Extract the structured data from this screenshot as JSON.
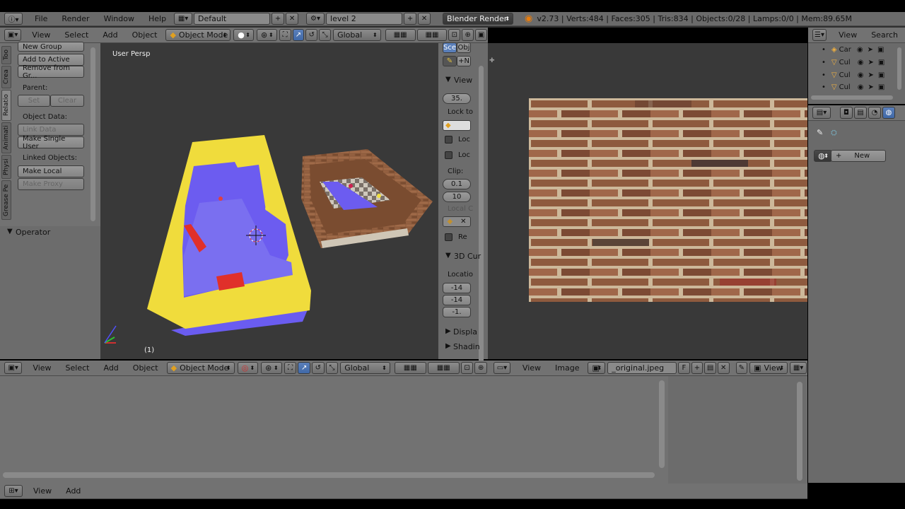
{
  "topbar": {
    "menus": [
      "File",
      "Render",
      "Window",
      "Help"
    ],
    "screen_layout": "Default",
    "scene": "level 2",
    "render_engine": "Blender Render",
    "stats": "v2.73 | Verts:484 | Faces:305 | Tris:834 | Objects:0/28 | Lamps:0/0 | Mem:89.65M"
  },
  "viewport_header": {
    "menus": [
      "View",
      "Select",
      "Add",
      "Object"
    ],
    "mode": "Object Mode",
    "orientation": "Global"
  },
  "tool_shelf": {
    "tabs": [
      "Too",
      "Crea",
      "Relatio",
      "Animati",
      "Physi",
      "Grease Pe"
    ],
    "group_buttons": [
      "New Group",
      "Add to Active",
      "Remove from Gr..."
    ],
    "parent_label": "Parent:",
    "parent_set": "Set",
    "parent_clear": "Clear",
    "object_data_label": "Object Data:",
    "link_data": "Link Data",
    "make_single_user": "Make Single User",
    "linked_objects_label": "Linked Objects:",
    "make_local": "Make Local",
    "make_proxy": "Make Proxy",
    "operator_label": "Operator"
  },
  "viewport": {
    "perspective_label": "User Persp",
    "frame_label": "(1)"
  },
  "properties_panel": {
    "tab_scene": "Sce",
    "tab_object": "Obj",
    "new_btn": "+N",
    "view_header": "View",
    "lens": "35.",
    "lock_to": "Lock to",
    "lock_loc": "Loc",
    "lock_loc2": "Loc",
    "clip_label": "Clip:",
    "clip_start": "0.1",
    "clip_end": "10",
    "local_camera": "Local C",
    "render_border": "Re",
    "cursor_header": "3D Cur",
    "location_label": "Locatio",
    "loc_x": "-14",
    "loc_y": "-14",
    "loc_z": "-1.",
    "display_header": "Displa",
    "shading_header": "Shadin"
  },
  "image_editor_header": {
    "menus": [
      "View",
      "Image"
    ],
    "image_name": "_original.jpeg",
    "fake_user": "F",
    "view_mode": "View"
  },
  "outliner": {
    "menus": [
      "View",
      "Search"
    ],
    "rows": [
      "Car",
      "Cul",
      "Cul",
      "Cul"
    ]
  },
  "properties_editor": {
    "new_button": "New"
  },
  "timeline_header": {
    "menus": [
      "View",
      "Add"
    ]
  },
  "colors": {
    "background_dark": "#393939",
    "header_gray": "#727272",
    "floor_yellow": "#f0dc3c",
    "wall_purple": "#6c5cf0",
    "selected_blue": "#5a7fba"
  }
}
